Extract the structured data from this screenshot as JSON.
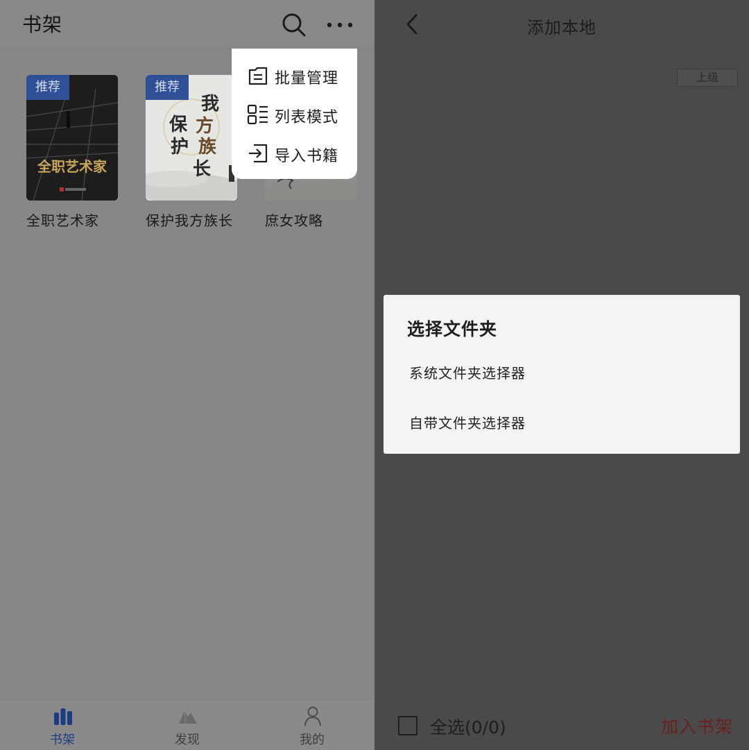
{
  "left": {
    "title": "书架",
    "icons": {
      "search": "search-icon",
      "more": "more-dots-icon"
    },
    "popup_menu": [
      {
        "label": "批量管理",
        "icon": "batch-manage-icon"
      },
      {
        "label": "列表模式",
        "icon": "list-mode-icon"
      },
      {
        "label": "导入书籍",
        "icon": "import-icon"
      }
    ],
    "books": [
      {
        "title": "全职艺术家",
        "tag": "推荐",
        "cover_text": "全职艺术家"
      },
      {
        "title": "保护我方族长",
        "tag": "推荐",
        "cover_text": "保护我方族长"
      },
      {
        "title": "庶女攻略",
        "tag": ""
      }
    ],
    "bottom_nav": [
      {
        "label": "书架",
        "icon": "bookshelf-icon",
        "active": true
      },
      {
        "label": "发现",
        "icon": "discover-icon",
        "active": false
      },
      {
        "label": "我的",
        "icon": "profile-icon",
        "active": false
      }
    ]
  },
  "right": {
    "title": "添加本地",
    "up_label": "上级",
    "dialog": {
      "title": "选择文件夹",
      "options": [
        "系统文件夹选择器",
        "自带文件夹选择器"
      ]
    },
    "select_all_label": "全选(0/0)",
    "add_to_shelf_label": "加入书架"
  },
  "colors": {
    "accent": "#2f4f96",
    "add_button": "#6b2020",
    "overlay": "#878787"
  }
}
